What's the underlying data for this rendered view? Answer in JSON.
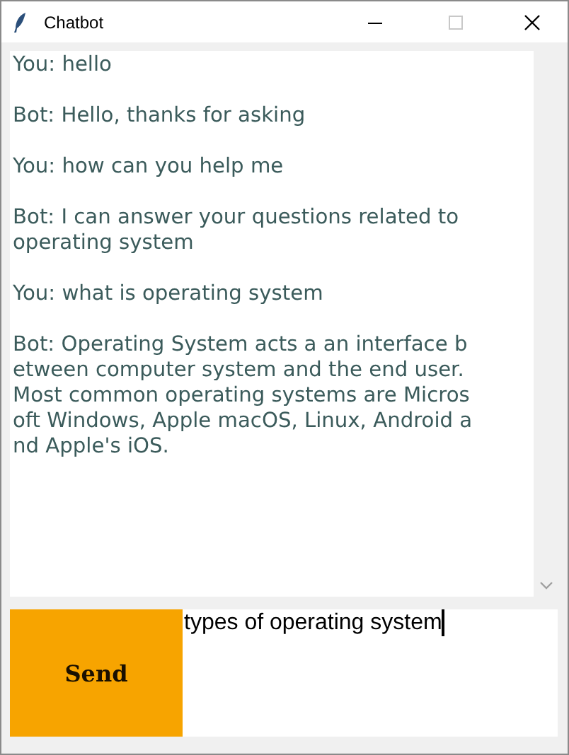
{
  "window": {
    "title": "Chatbot"
  },
  "messages": [
    {
      "lines": [
        "You: hello"
      ]
    },
    {
      "lines": [
        "Bot: Hello, thanks for asking"
      ]
    },
    {
      "lines": [
        "You: how can you help me"
      ]
    },
    {
      "lines": [
        "Bot: I can answer your questions related to",
        "operating system"
      ]
    },
    {
      "lines": [
        "You: what is operating system"
      ]
    },
    {
      "lines": [
        "Bot: Operating System acts a an interface b",
        "etween computer system and the end user.",
        "Most common operating systems are Micros",
        "oft Windows, Apple macOS, Linux, Android a",
        "nd Apple's iOS."
      ]
    }
  ],
  "send_button": {
    "label": "Send"
  },
  "input": {
    "value": "types of operating system"
  }
}
